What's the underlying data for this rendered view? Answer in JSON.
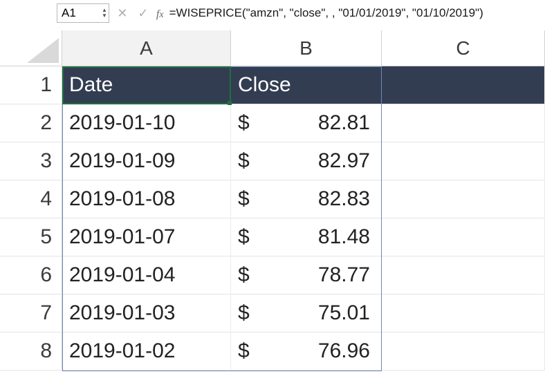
{
  "nameBox": "A1",
  "formula": "=WISEPRICE(\"amzn\", \"close\", , \"01/01/2019\", \"01/10/2019\")",
  "columns": [
    "A",
    "B",
    "C"
  ],
  "headerRow": {
    "num": "1",
    "A": "Date",
    "B": "Close"
  },
  "rows": [
    {
      "num": "2",
      "date": "2019-01-10",
      "currency": "$",
      "close": "82.81"
    },
    {
      "num": "3",
      "date": "2019-01-09",
      "currency": "$",
      "close": "82.97"
    },
    {
      "num": "4",
      "date": "2019-01-08",
      "currency": "$",
      "close": "82.83"
    },
    {
      "num": "5",
      "date": "2019-01-07",
      "currency": "$",
      "close": "81.48"
    },
    {
      "num": "6",
      "date": "2019-01-04",
      "currency": "$",
      "close": "78.77"
    },
    {
      "num": "7",
      "date": "2019-01-03",
      "currency": "$",
      "close": "75.01"
    },
    {
      "num": "8",
      "date": "2019-01-02",
      "currency": "$",
      "close": "76.96"
    }
  ],
  "colors": {
    "headerFill": "#333d52",
    "selection": "#1f6f41"
  }
}
